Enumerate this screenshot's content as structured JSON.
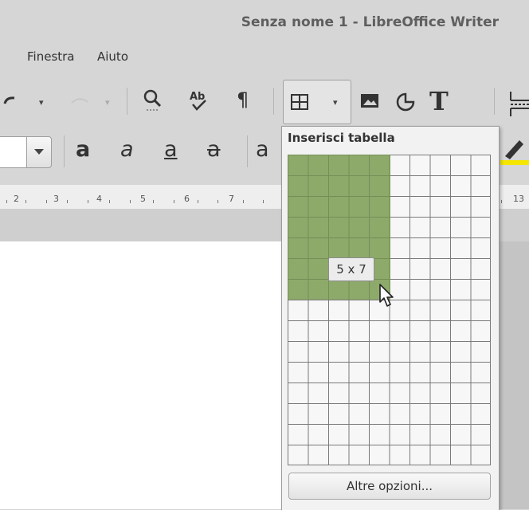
{
  "window": {
    "title": "Senza nome 1 - LibreOffice Writer"
  },
  "menubar": {
    "items": [
      "Finestra",
      "Aiuto"
    ]
  },
  "ruler": {
    "numbers": [
      "2",
      "3",
      "4",
      "5",
      "6",
      "7",
      "13"
    ]
  },
  "insert_table_popup": {
    "title": "Inserisci tabella",
    "size_label": "5 x 7",
    "columns_selected": 5,
    "rows_selected": 7,
    "grid_columns": 10,
    "grid_rows": 15,
    "more_options_label": "Altre opzioni..."
  },
  "colors": {
    "selection": "#8daa6b",
    "highlight": "#f5e600"
  }
}
